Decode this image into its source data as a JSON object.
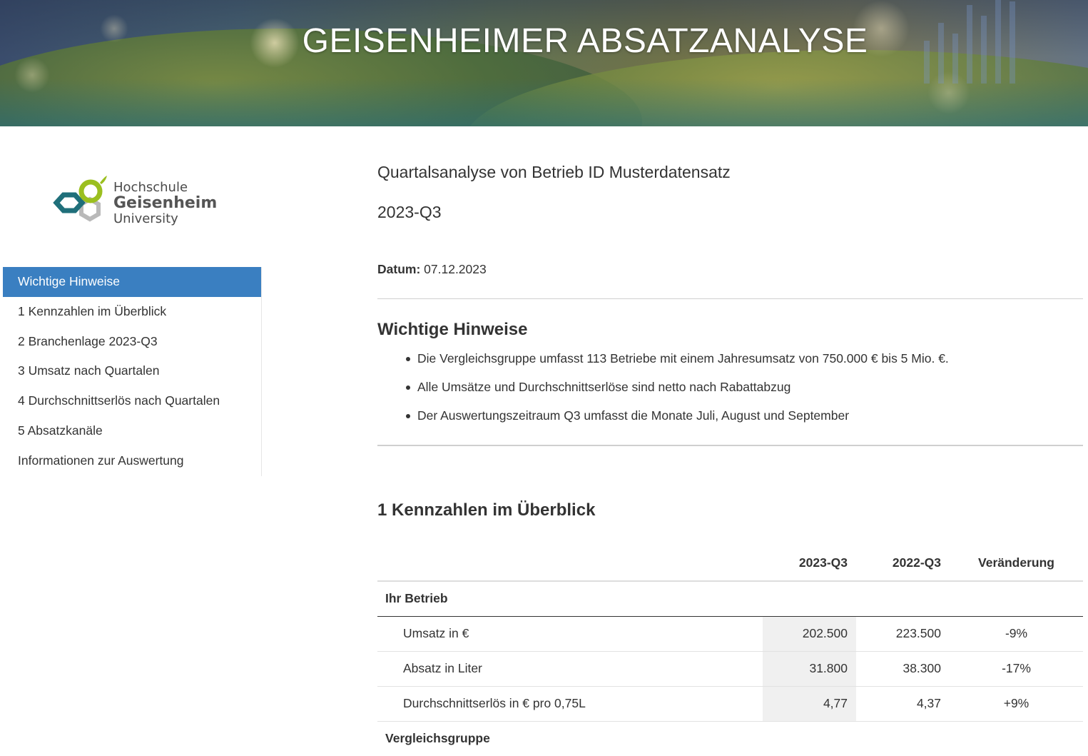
{
  "header": {
    "title": "GEISENHEIMER ABSATZANALYSE"
  },
  "logo": {
    "line1": "Hochschule",
    "line2": "Geisenheim",
    "line3": "University",
    "colors": {
      "green": "#9bbf1f",
      "teal": "#1f6f7a",
      "gray": "#b9b9b9"
    }
  },
  "sidebar": {
    "accent_color": "#3a7fc1",
    "items": [
      {
        "label": "Wichtige Hinweise",
        "active": true
      },
      {
        "label": "1 Kennzahlen im Überblick"
      },
      {
        "label": "2 Branchenlage 2023-Q3"
      },
      {
        "label": "3 Umsatz nach Quartalen"
      },
      {
        "label": "4 Durchschnittserlös nach Quartalen"
      },
      {
        "label": "5 Absatzkanäle"
      },
      {
        "label": "Informationen zur Auswertung"
      }
    ]
  },
  "report": {
    "title": "Quartalsanalyse von Betrieb ID Musterdatensatz",
    "period": "2023-Q3",
    "date_label": "Datum:",
    "date_value": "07.12.2023"
  },
  "hinweise": {
    "heading": "Wichtige Hinweise",
    "items": [
      "Die Vergleichsgruppe umfasst 113 Betriebe mit einem Jahresumsatz von 750.000 € bis 5 Mio. €.",
      "Alle Umsätze und Durchschnittserlöse sind netto nach Rabattabzug",
      "Der Auswertungszeitraum Q3 umfasst die Monate Juli, August und September"
    ]
  },
  "kennzahlen": {
    "heading": "1 Kennzahlen im Überblick",
    "columns": [
      "",
      "2023-Q3",
      "2022-Q3",
      "Veränderung"
    ],
    "group1": "Ihr Betrieb",
    "rows": [
      {
        "label": "Umsatz in €",
        "current": "202.500",
        "previous": "223.500",
        "change": "-9%"
      },
      {
        "label": "Absatz in Liter",
        "current": "31.800",
        "previous": "38.300",
        "change": "-17%"
      },
      {
        "label": "Durchschnittserlös in € pro 0,75L",
        "current": "4,77",
        "previous": "4,37",
        "change": "+9%"
      }
    ],
    "group2": "Vergleichsgruppe"
  }
}
